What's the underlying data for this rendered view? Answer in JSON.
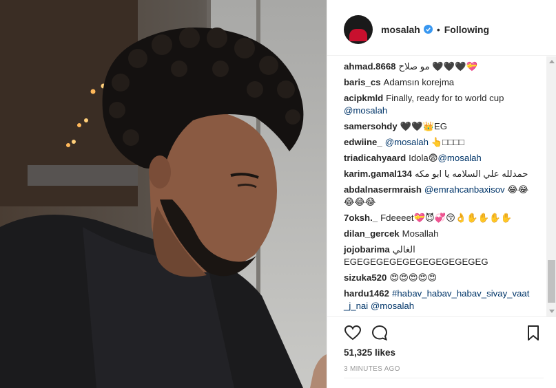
{
  "post": {
    "username": "mosalah",
    "separator": "•",
    "follow_status": "Following"
  },
  "comments": [
    {
      "user": "ahmad.8668",
      "text": "مو صلاح 🖤🖤🖤💝",
      "mention": ""
    },
    {
      "user": "baris_cs",
      "text": "Adamsın korejma",
      "mention": ""
    },
    {
      "user": "acipkmld",
      "text": "Finally, ready for to world cup",
      "mention": "@mosalah"
    },
    {
      "user": "samersohdy",
      "text": "🖤🖤👑EG",
      "mention": ""
    },
    {
      "user": "edwiine_",
      "text": "",
      "mention": "@mosalah",
      "suffix": " 👆□□□□"
    },
    {
      "user": "triadicahyaard",
      "text": "Idola😨",
      "mention": "@mosalah"
    },
    {
      "user": "karim.gamal134",
      "text": "حمدلله علي السلامه يا ابو مكه",
      "mention": ""
    },
    {
      "user": "abdalnasermraish",
      "text": "",
      "mention": "@emrahcanbaxisov",
      "suffix": " 😂😂😂😂😂"
    },
    {
      "user": "7oksh._",
      "text": "Fdeeeet💝😈💞😚👌✋✋✋✋",
      "mention": ""
    },
    {
      "user": "dilan_gercek",
      "text": "Mosallah",
      "mention": ""
    },
    {
      "user": "jojobarima",
      "text": "الغالي EGEGEGEGEGEGEGEGEGEGEG",
      "mention": ""
    },
    {
      "user": "sizuka520",
      "text": "😍😍😍😍😍",
      "mention": ""
    },
    {
      "user": "hardu1462",
      "text": "",
      "mention": "#habav_habav_habav_sivay_vaat_j_nai @mosalah"
    }
  ],
  "likes": "51,325 likes",
  "timestamp": "3 MINUTES AGO",
  "icons": [
    "heart-icon",
    "comment-icon",
    "bookmark-icon",
    "verified-badge-icon"
  ],
  "colors": {
    "link": "#003569",
    "verified": "#3897f0",
    "text": "#262626",
    "muted": "#999999"
  }
}
